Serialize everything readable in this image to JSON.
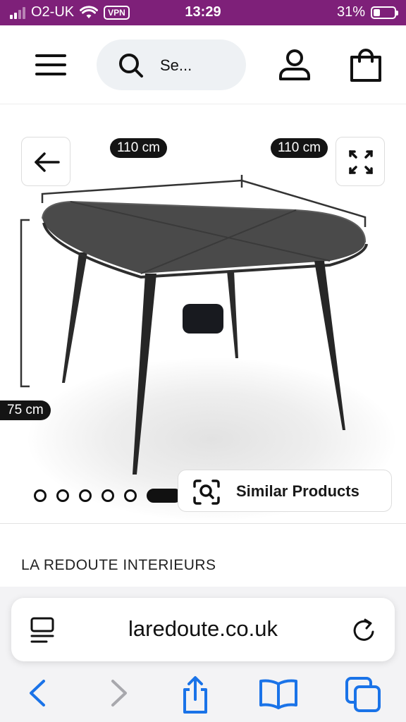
{
  "status_bar": {
    "carrier": "O2-UK",
    "vpn": "VPN",
    "time": "13:29",
    "battery": "31%",
    "battery_level": 0.31
  },
  "header": {
    "search_placeholder": "Se..."
  },
  "gallery": {
    "dims": {
      "width_left": "110 cm",
      "width_right": "110 cm",
      "height": "75 cm"
    },
    "dot_count": 6,
    "active_index": 5,
    "similar_label": "Similar Products"
  },
  "brand": "LA REDOUTE INTERIEURS",
  "browser": {
    "url": "laredoute.co.uk"
  },
  "colors": {
    "status_bar": "#7e2079",
    "ios_blue": "#1a73e8",
    "dark": "#141414"
  }
}
